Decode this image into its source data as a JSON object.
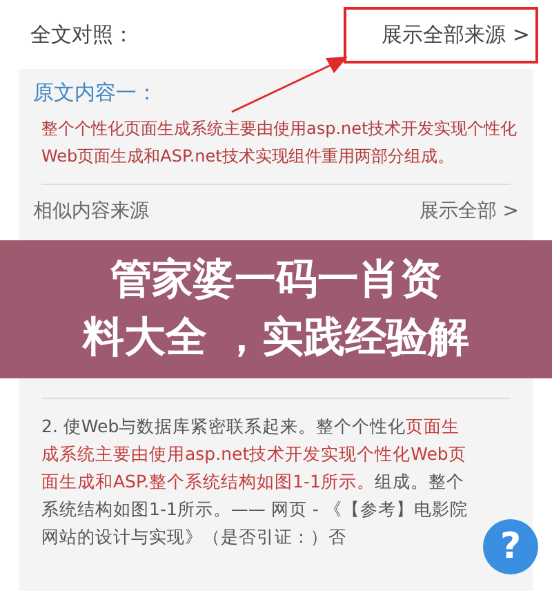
{
  "header": {
    "title": "全文对照：",
    "link": "展示全部来源 >"
  },
  "original": {
    "heading": "原文内容一：",
    "text": "整个个性化页面生成系统主要由使用asp.net技术开发实现个性化Web页面生成和ASP.net技术实现组件重用两部分组成。"
  },
  "similar": {
    "heading": "相似内容来源",
    "link": "展示全部 >",
    "items": [
      {
        "segments": [
          {
            "kind": "plain",
            "text": "2. 使Web与数据库紧密联系起来。整个个性化"
          },
          {
            "kind": "highlight",
            "text": "页面生成系统主要由使用asp.net技术开发实现个性化Web页面生成和ASP.整个系统结构如图1-1所示。"
          },
          {
            "kind": "plain",
            "text": "组成。整个系统结构如图1-1所示。—— 网页 - 《【参考】电影院网站的设计与实现》（是否引证：）否"
          }
        ]
      }
    ]
  },
  "banner": {
    "lines": [
      "管家婆一码一肖资",
      "料大全 ，实践经验解"
    ]
  },
  "help_button": {
    "label": "?"
  }
}
